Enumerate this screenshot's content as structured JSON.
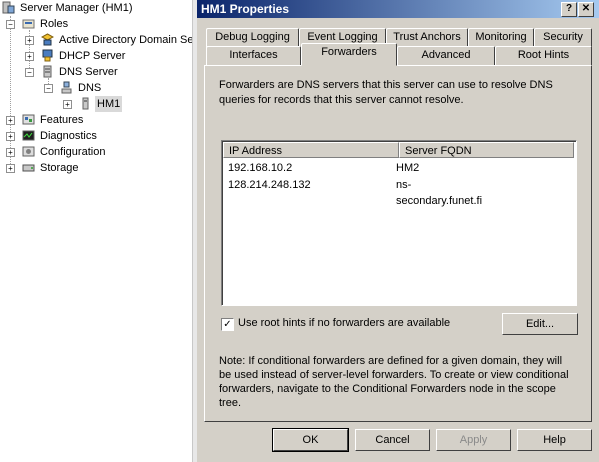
{
  "tree": {
    "root": "Server Manager (HM1)",
    "items": [
      {
        "label": "Roles",
        "expander": "−"
      },
      {
        "label": "Active Directory Domain Se",
        "expander": "+"
      },
      {
        "label": "DHCP Server",
        "expander": "+"
      },
      {
        "label": "DNS Server",
        "expander": "−"
      },
      {
        "label": "DNS",
        "expander": "−"
      },
      {
        "label": "HM1",
        "expander": "+"
      },
      {
        "label": "Features",
        "expander": "+"
      },
      {
        "label": "Diagnostics",
        "expander": "+"
      },
      {
        "label": "Configuration",
        "expander": "+"
      },
      {
        "label": "Storage",
        "expander": "+"
      }
    ]
  },
  "dialog": {
    "title": "HM1 Properties",
    "help_glyph": "?",
    "close_glyph": "✕",
    "tabs_row1": [
      "Debug Logging",
      "Event Logging",
      "Trust Anchors",
      "Monitoring",
      "Security"
    ],
    "tabs_row2": [
      "Interfaces",
      "Forwarders",
      "Advanced",
      "Root Hints"
    ],
    "active_tab": "Forwarders",
    "description": "Forwarders are DNS servers that this server can use to resolve DNS queries for records that this server cannot resolve.",
    "list": {
      "columns": [
        "IP Address",
        "Server FQDN"
      ],
      "rows": [
        [
          "192.168.10.2",
          "HM2"
        ],
        [
          "128.214.248.132",
          "ns-secondary.funet.fi"
        ]
      ]
    },
    "root_hints_checkbox": {
      "label": "Use root hints if no forwarders are available",
      "checked": true,
      "glyph": "✓"
    },
    "edit_label": "Edit...",
    "note": "Note: If conditional forwarders are defined for a given domain, they will be used instead of server-level forwarders.  To create or view conditional forwarders, navigate to the Conditional Forwarders node in the scope tree.",
    "buttons": {
      "ok": "OK",
      "cancel": "Cancel",
      "apply": "Apply",
      "help": "Help"
    }
  },
  "colors": {
    "title_start": "#0a246a",
    "title_end": "#a6caf0",
    "dialog_bg": "#d4d0c8"
  }
}
